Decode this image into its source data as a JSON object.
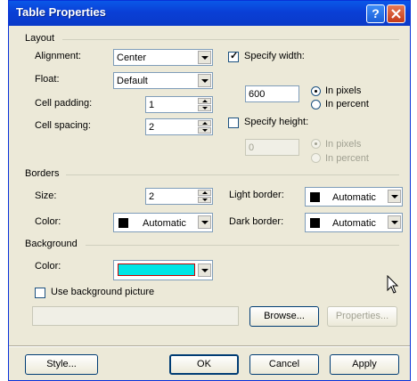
{
  "window": {
    "title": "Table Properties"
  },
  "layout": {
    "group_label": "Layout",
    "alignment_label": "Alignment:",
    "alignment_value": "Center",
    "float_label": "Float:",
    "float_value": "Default",
    "cell_padding_label": "Cell padding:",
    "cell_padding_value": "1",
    "cell_spacing_label": "Cell spacing:",
    "cell_spacing_value": "2",
    "specify_width_label": "Specify width:",
    "width_value": "600",
    "in_pixels_label": "In pixels",
    "in_percent_label": "In percent",
    "specify_height_label": "Specify height:",
    "height_value": "0",
    "height_in_pixels_label": "In pixels",
    "height_in_percent_label": "In percent"
  },
  "borders": {
    "group_label": "Borders",
    "size_label": "Size:",
    "size_value": "2",
    "color_label": "Color:",
    "color_value": "Automatic",
    "light_border_label": "Light border:",
    "light_border_value": "Automatic",
    "dark_border_label": "Dark border:",
    "dark_border_value": "Automatic"
  },
  "background": {
    "group_label": "Background",
    "color_label": "Color:",
    "color_hex": "#00e5e5",
    "use_picture_label": "Use background picture",
    "picture_path": "",
    "browse_label": "Browse...",
    "properties_label": "Properties..."
  },
  "footer": {
    "style_label": "Style...",
    "ok_label": "OK",
    "cancel_label": "Cancel",
    "apply_label": "Apply"
  }
}
